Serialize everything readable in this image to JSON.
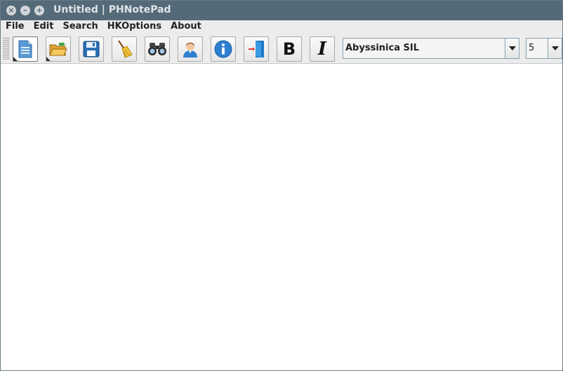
{
  "window": {
    "title": "Untitled | PHNotePad",
    "controls": {
      "close": "×",
      "minimize": "–",
      "maximize": "+"
    }
  },
  "menu": {
    "items": [
      "File",
      "Edit",
      "Search",
      "HKOptions",
      "About"
    ]
  },
  "toolbar": {
    "buttons": [
      {
        "icon": "new-document-icon"
      },
      {
        "icon": "open-folder-icon"
      },
      {
        "icon": "save-floppy-icon"
      },
      {
        "icon": "clear-broom-icon"
      },
      {
        "icon": "find-binoculars-icon"
      },
      {
        "icon": "user-icon"
      },
      {
        "icon": "info-icon"
      },
      {
        "icon": "exit-door-icon"
      },
      {
        "icon": "bold-icon",
        "glyph": "B"
      },
      {
        "icon": "italic-icon",
        "glyph": "I"
      }
    ],
    "font_family": "Abyssinica SIL",
    "font_size": "5"
  },
  "editor": {
    "content": ""
  },
  "colors": {
    "titlebar": "#546a78",
    "menubar": "#ececec",
    "info_blue": "#2f7fd1",
    "save_blue": "#2a6fb5"
  }
}
